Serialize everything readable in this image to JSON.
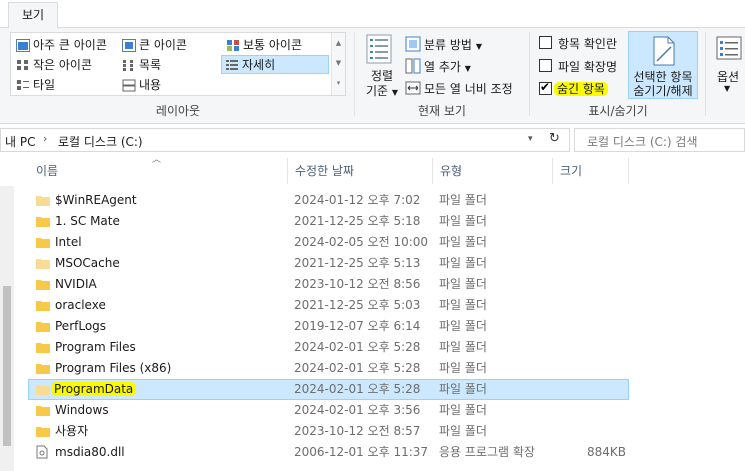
{
  "tab": {
    "label": "보기"
  },
  "layout": {
    "items": [
      {
        "label": "아주 큰 아이콘",
        "icon": "extra-large-icons-icon"
      },
      {
        "label": "큰 아이콘",
        "icon": "large-icons-icon"
      },
      {
        "label": "보통 아이콘",
        "icon": "medium-icons-icon"
      },
      {
        "label": "작은 아이콘",
        "icon": "small-icons-icon"
      },
      {
        "label": "목록",
        "icon": "list-icon"
      },
      {
        "label": "자세히",
        "icon": "details-icon",
        "selected": true
      },
      {
        "label": "타일",
        "icon": "tiles-icon"
      },
      {
        "label": "내용",
        "icon": "content-icon"
      }
    ],
    "title": "레이아웃"
  },
  "current_view": {
    "sort_label": "정렬\n기준",
    "sort_label_1": "정렬",
    "sort_label_2": "기준",
    "group_by": "분류 방법",
    "add_column": "열 추가",
    "size_all_columns": "모든 열 너비 조정",
    "title": "현재 보기"
  },
  "show_hide": {
    "item_check_boxes": "항목 확인란",
    "file_name_extensions": "파일 확장명",
    "hidden_items": "숨긴 항목",
    "hide_selected_1": "선택한 항목",
    "hide_selected_2": "숨기기/해제",
    "title": "표시/숨기기",
    "item_check_boxes_checked": false,
    "file_name_extensions_checked": false,
    "hidden_items_checked": true
  },
  "options": {
    "label": "옵션"
  },
  "address": {
    "crumb1": "내 PC",
    "crumb2": "로컬 디스크 (C:)",
    "search_placeholder": "로컬 디스크 (C:) 검색"
  },
  "columns": {
    "name": "이름",
    "modified": "수정한 날짜",
    "type": "유형",
    "size": "크기"
  },
  "files": [
    {
      "name": "$WinREAgent",
      "modified": "2024-01-12 오후 7:02",
      "type": "파일 폴더",
      "size": "",
      "kind": "folder-light"
    },
    {
      "name": "1. SC Mate",
      "modified": "2021-12-25 오후 5:18",
      "type": "파일 폴더",
      "size": "",
      "kind": "folder"
    },
    {
      "name": "Intel",
      "modified": "2024-02-05 오전 10:00",
      "type": "파일 폴더",
      "size": "",
      "kind": "folder"
    },
    {
      "name": "MSOCache",
      "modified": "2021-12-25 오후 5:13",
      "type": "파일 폴더",
      "size": "",
      "kind": "folder-light"
    },
    {
      "name": "NVIDIA",
      "modified": "2023-10-12 오전 8:56",
      "type": "파일 폴더",
      "size": "",
      "kind": "folder"
    },
    {
      "name": "oraclexe",
      "modified": "2021-12-25 오후 5:03",
      "type": "파일 폴더",
      "size": "",
      "kind": "folder"
    },
    {
      "name": "PerfLogs",
      "modified": "2019-12-07 오후 6:14",
      "type": "파일 폴더",
      "size": "",
      "kind": "folder"
    },
    {
      "name": "Program Files",
      "modified": "2024-02-01 오후 5:28",
      "type": "파일 폴더",
      "size": "",
      "kind": "folder"
    },
    {
      "name": "Program Files (x86)",
      "modified": "2024-02-01 오후 5:28",
      "type": "파일 폴더",
      "size": "",
      "kind": "folder"
    },
    {
      "name": "ProgramData",
      "modified": "2024-02-01 오후 5:28",
      "type": "파일 폴더",
      "size": "",
      "kind": "folder-light",
      "selected": true,
      "highlighted": true
    },
    {
      "name": "Windows",
      "modified": "2024-02-01 오후 3:56",
      "type": "파일 폴더",
      "size": "",
      "kind": "folder"
    },
    {
      "name": "사용자",
      "modified": "2023-10-12 오전 8:57",
      "type": "파일 폴더",
      "size": "",
      "kind": "folder"
    },
    {
      "name": "msdia80.dll",
      "modified": "2006-12-01 오후 11:37",
      "type": "응용 프로그램 확장",
      "size": "884KB",
      "kind": "file"
    }
  ],
  "colors": {
    "selection": "#cce8ff",
    "highlight": "#fafa00",
    "folder": "#f8c84a"
  }
}
